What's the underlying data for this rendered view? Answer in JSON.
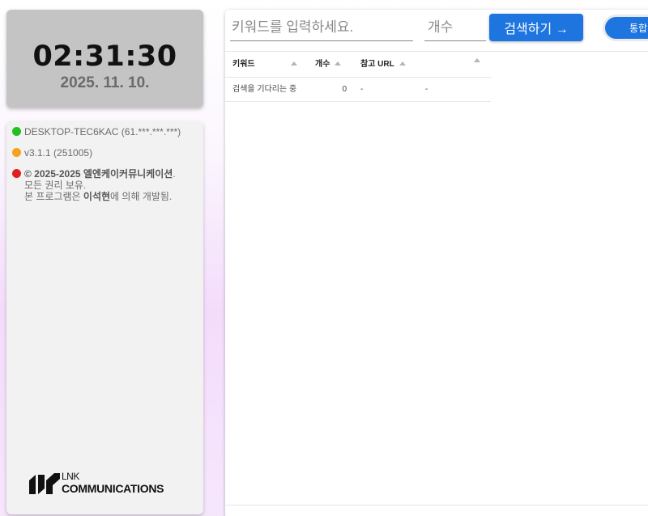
{
  "clock": {
    "time": "02:31:30",
    "date": "2025. 11. 10."
  },
  "info": {
    "device": "DESKTOP-TEC6KAC (61.***.***.***)",
    "device_status_color": "#22c022",
    "version": "v3.1.1 (251005)",
    "version_status_color": "#f5a31a",
    "copyright_bold": "© 2025-2025 엘엔케이커뮤니케이션",
    "copyright_tail": ".",
    "rights": "모든 권리 보유.",
    "dev_prefix": "본 프로그램은 ",
    "dev_name": "이석현",
    "dev_suffix": "에 의해 개발됨.",
    "copyright_status_color": "#e02020"
  },
  "logo": {
    "top_text": "LNK",
    "bottom_text": "COMMUNICATIONS"
  },
  "search": {
    "keyword_placeholder": "키워드를 입력하세요.",
    "count_placeholder": "개수",
    "search_button": "검색하기 →",
    "integrated_button": "통합"
  },
  "table": {
    "columns": [
      "키워드",
      "개수",
      "참고 URL"
    ],
    "rows": [
      {
        "keyword": "검색을 기다리는 중",
        "count": "0",
        "url": "-",
        "extra": "-"
      }
    ]
  },
  "colors": {
    "accent": "#1f75e0",
    "clock_bg": "#c4c4c4",
    "info_bg": "#f2f2f2"
  }
}
